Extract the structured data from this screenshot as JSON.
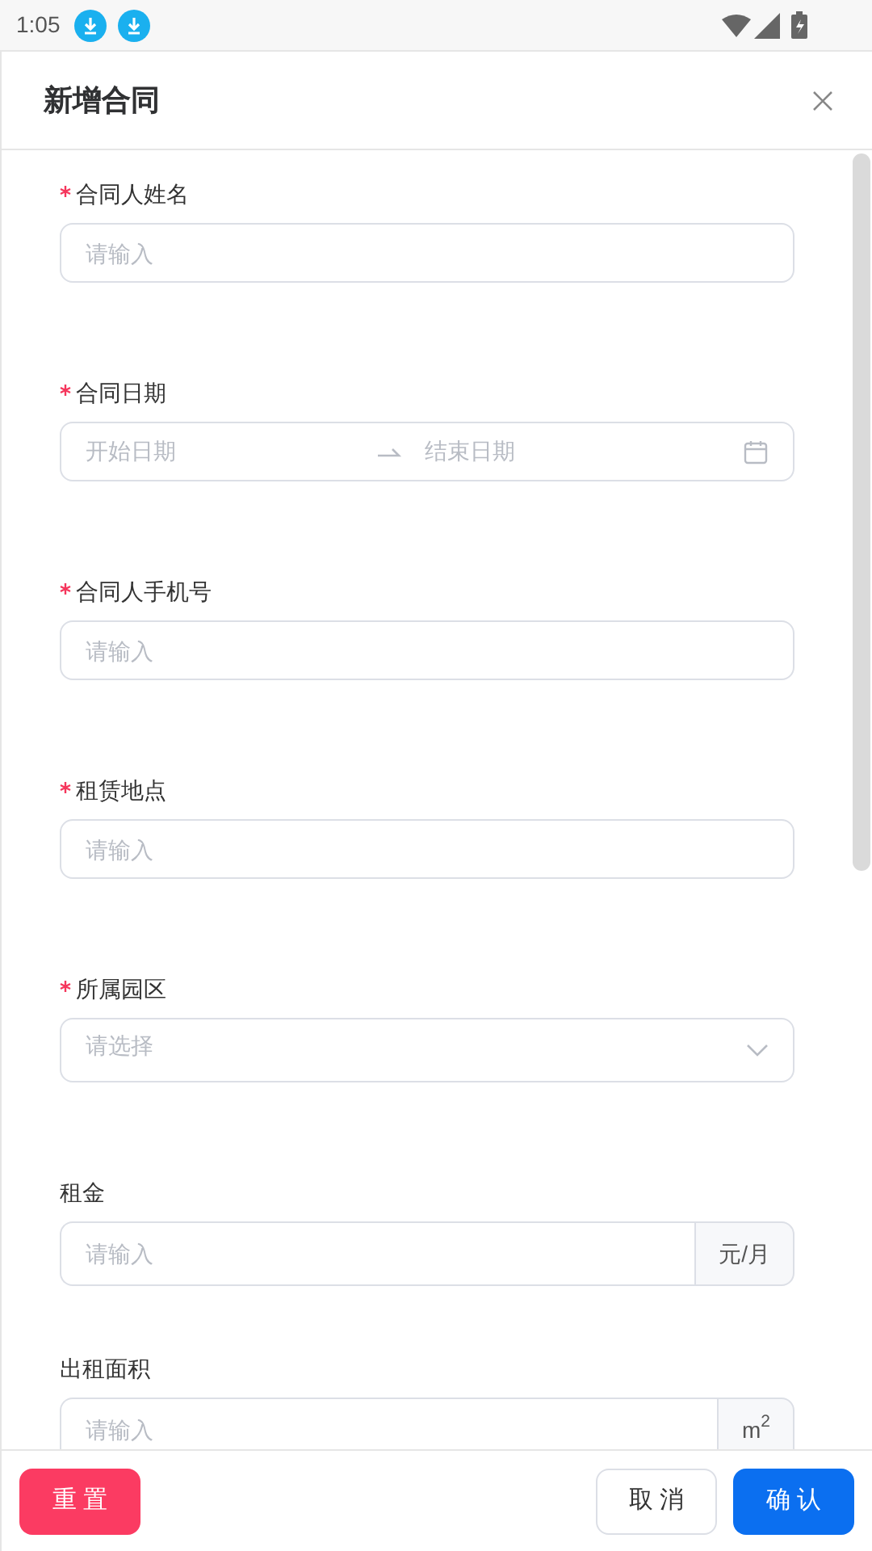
{
  "status_bar": {
    "time": "1:05"
  },
  "dialog": {
    "title": "新增合同"
  },
  "fields": [
    {
      "kind": "text",
      "label": "合同人姓名",
      "required": true,
      "placeholder": "请输入"
    },
    {
      "kind": "daterange",
      "label": "合同日期",
      "required": true,
      "start_placeholder": "开始日期",
      "end_placeholder": "结束日期"
    },
    {
      "kind": "text",
      "label": "合同人手机号",
      "required": true,
      "placeholder": "请输入"
    },
    {
      "kind": "text",
      "label": "租赁地点",
      "required": true,
      "placeholder": "请输入"
    },
    {
      "kind": "select",
      "label": "所属园区",
      "required": true,
      "placeholder": "请选择"
    },
    {
      "kind": "addon",
      "label": "租金",
      "required": false,
      "placeholder": "请输入",
      "unit": "元/月"
    },
    {
      "kind": "addon",
      "label": "出租面积",
      "required": false,
      "placeholder": "请输入",
      "unit": "m$^{2}$"
    }
  ],
  "footer": {
    "reset": "重 置",
    "cancel": "取 消",
    "confirm": "确 认"
  }
}
